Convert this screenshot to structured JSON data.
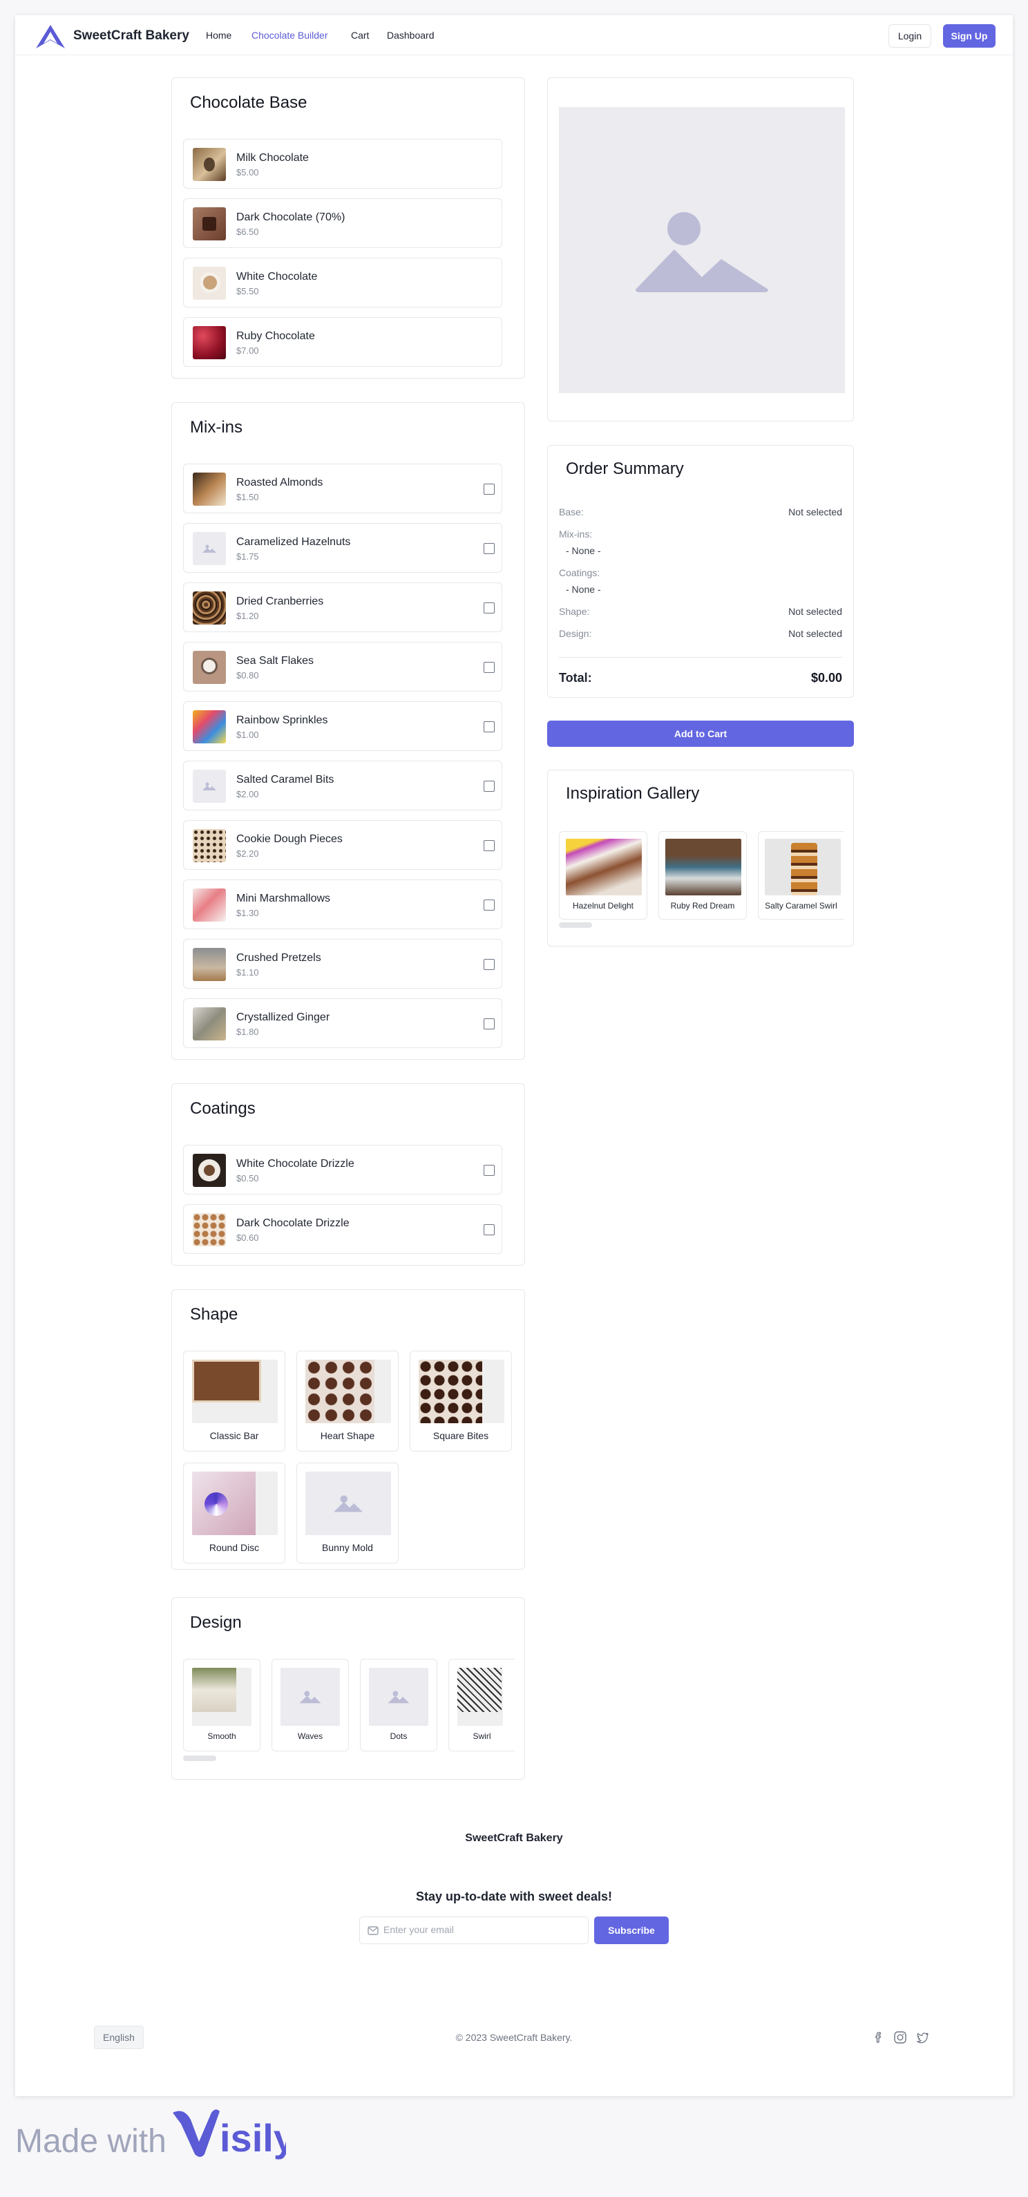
{
  "nav": {
    "brand": "SweetCraft Bakery",
    "links": [
      "Home",
      "Chocolate Builder",
      "Cart",
      "Dashboard"
    ],
    "login": "Login",
    "signup": "Sign Up"
  },
  "base": {
    "title": "Chocolate Base",
    "items": [
      {
        "name": "Milk Chocolate",
        "price": "$5.00"
      },
      {
        "name": "Dark Chocolate (70%)",
        "price": "$6.50"
      },
      {
        "name": "White Chocolate",
        "price": "$5.50"
      },
      {
        "name": "Ruby Chocolate",
        "price": "$7.00"
      }
    ]
  },
  "mixins": {
    "title": "Mix-ins",
    "items": [
      {
        "name": "Roasted Almonds",
        "price": "$1.50"
      },
      {
        "name": "Caramelized Hazelnuts",
        "price": "$1.75"
      },
      {
        "name": "Dried Cranberries",
        "price": "$1.20"
      },
      {
        "name": "Sea Salt Flakes",
        "price": "$0.80"
      },
      {
        "name": "Rainbow Sprinkles",
        "price": "$1.00"
      },
      {
        "name": "Salted Caramel Bits",
        "price": "$2.00"
      },
      {
        "name": "Cookie Dough Pieces",
        "price": "$2.20"
      },
      {
        "name": "Mini Marshmallows",
        "price": "$1.30"
      },
      {
        "name": "Crushed Pretzels",
        "price": "$1.10"
      },
      {
        "name": "Crystallized Ginger",
        "price": "$1.80"
      }
    ]
  },
  "coatings": {
    "title": "Coatings",
    "items": [
      {
        "name": "White Chocolate Drizzle",
        "price": "$0.50"
      },
      {
        "name": "Dark Chocolate Drizzle",
        "price": "$0.60"
      }
    ]
  },
  "shape": {
    "title": "Shape",
    "items": [
      "Classic Bar",
      "Heart Shape",
      "Square Bites",
      "Round Disc",
      "Bunny Mold"
    ]
  },
  "design": {
    "title": "Design",
    "items": [
      "Smooth",
      "Waves",
      "Dots",
      "Swirl"
    ]
  },
  "summary": {
    "title": "Order Summary",
    "base_label": "Base:",
    "base_value": "Not selected",
    "mixins_label": "Mix-ins:",
    "mixins_value": "- None -",
    "coatings_label": "Coatings:",
    "coatings_value": "- None -",
    "shape_label": "Shape:",
    "shape_value": "Not selected",
    "design_label": "Design:",
    "design_value": "Not selected",
    "total_label": "Total:",
    "total_value": "$0.00"
  },
  "add_to_cart": "Add to Cart",
  "gallery": {
    "title": "Inspiration Gallery",
    "items": [
      "Hazelnut Delight",
      "Ruby Red Dream",
      "Salty Caramel Swirl"
    ]
  },
  "footer": {
    "brand": "SweetCraft Bakery",
    "cta": "Stay up-to-date with sweet deals!",
    "email_placeholder": "Enter your email",
    "subscribe": "Subscribe",
    "language": "English",
    "copyright": "© 2023 SweetCraft Bakery."
  },
  "made_with": "Made with",
  "made_with_logo": "Visily",
  "colors": {
    "accent": "#6366e1",
    "placeholder": "#bcbcd6"
  }
}
